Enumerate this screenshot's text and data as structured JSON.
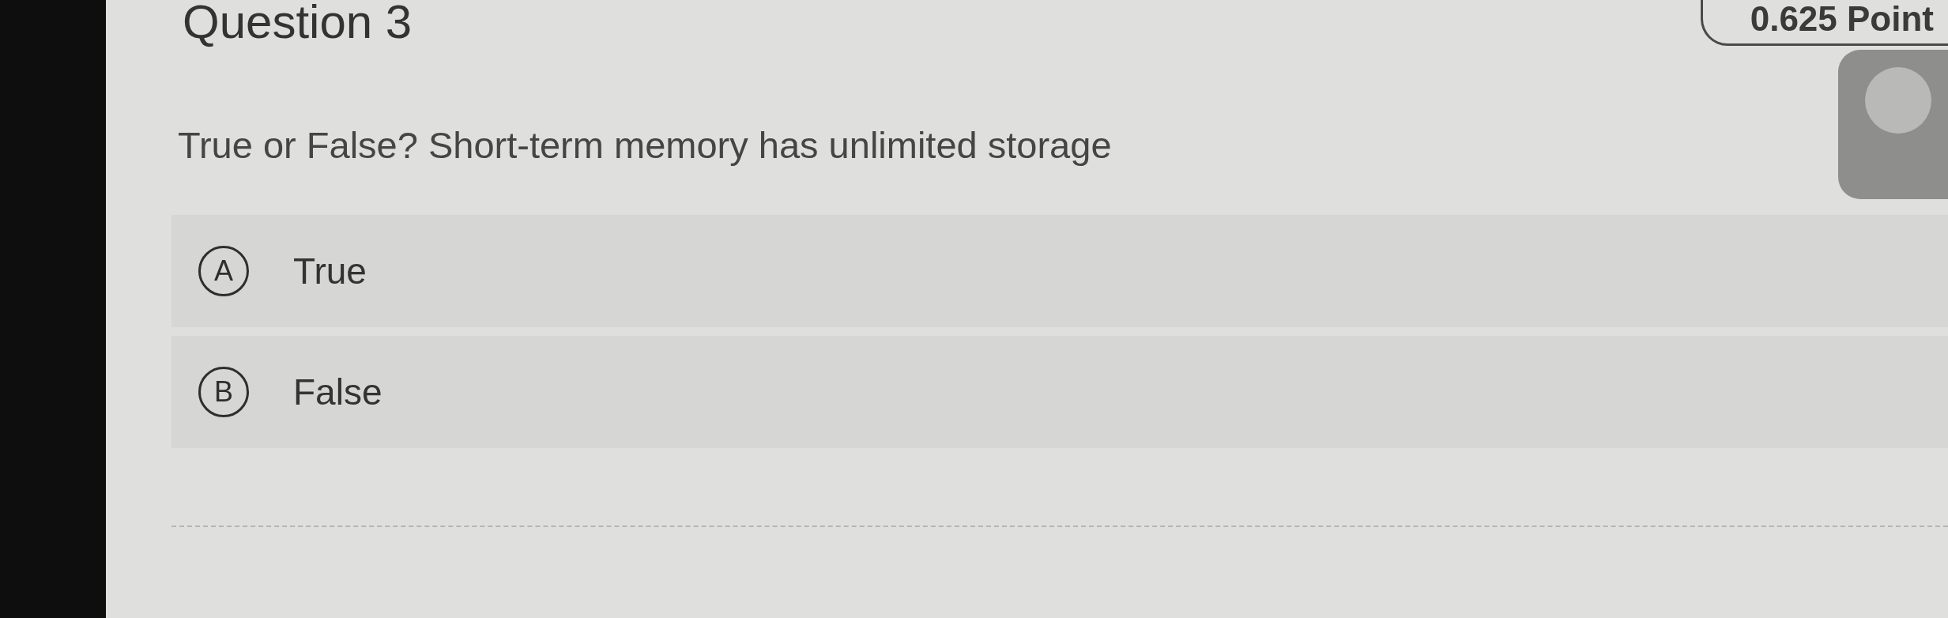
{
  "question": {
    "title": "Question 3",
    "points": "0.625 Point",
    "text": "True or False? Short-term memory has unlimited storage"
  },
  "options": [
    {
      "letter": "A",
      "label": "True",
      "selected": false
    },
    {
      "letter": "B",
      "label": "False",
      "selected": false
    }
  ]
}
